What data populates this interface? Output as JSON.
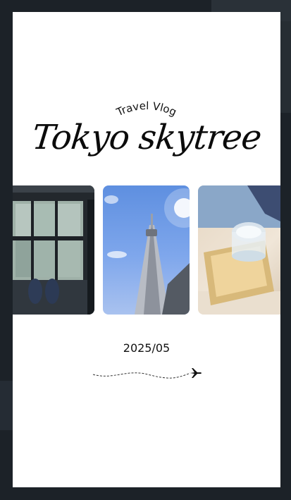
{
  "card": {
    "subtitle": "Travel Vlog",
    "title": "Tokyo skytree",
    "date": "2025/05"
  },
  "photos": [
    {
      "subject": "glass floor with feet and city below"
    },
    {
      "subject": "Tokyo Skytree tower against blue sky"
    },
    {
      "subject": "glass of sake in wooden masu box"
    }
  ],
  "icons": {
    "route": "airplane-icon"
  },
  "colors": {
    "backdrop": "#1c2228",
    "card": "#ffffff",
    "text": "#111111"
  }
}
